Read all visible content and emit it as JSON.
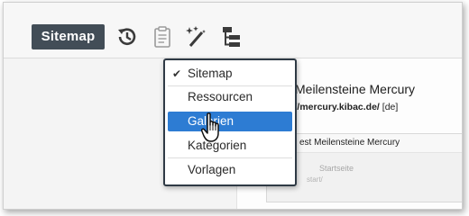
{
  "toolbar": {
    "sitemap_label": "Sitemap",
    "icons": [
      "history-icon",
      "clipboard-icon",
      "magic-wand-icon",
      "sitemap-tree-icon"
    ]
  },
  "page": {
    "title": "Meilensteine Mercury",
    "url_prefix": "://mercury.kibac.de/",
    "url_suffix": "[de]",
    "panel_header": "est Meilensteine Mercury",
    "faded_line_1": "Startseite",
    "faded_line_2": "start/"
  },
  "dropdown": {
    "items": [
      {
        "label": "Sitemap",
        "checked": true
      },
      {
        "label": "Ressourcen"
      },
      {
        "label": "Galerien",
        "active": true
      },
      {
        "label": "Kategorien"
      },
      {
        "label": "Vorlagen"
      }
    ]
  },
  "colors": {
    "accent": "#2d7cd3",
    "button_bg": "#424d57",
    "menu_border": "#2f3a45"
  }
}
